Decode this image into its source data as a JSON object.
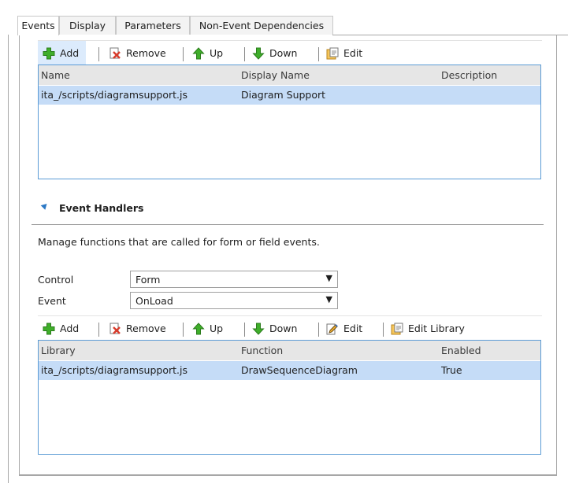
{
  "tabs": [
    {
      "label": "Events",
      "active": true
    },
    {
      "label": "Display",
      "active": false
    },
    {
      "label": "Parameters",
      "active": false
    },
    {
      "label": "Non-Event Dependencies",
      "active": false
    }
  ],
  "libraries_toolbar": {
    "add": "Add",
    "remove": "Remove",
    "up": "Up",
    "down": "Down",
    "edit": "Edit"
  },
  "libraries_grid": {
    "columns": [
      "Name",
      "Display Name",
      "Description"
    ],
    "rows": [
      {
        "name": "ita_/scripts/diagramsupport.js",
        "display_name": "Diagram Support",
        "description": ""
      }
    ]
  },
  "event_handlers": {
    "title": "Event Handlers",
    "description": "Manage functions that are called for form or field events.",
    "control_label": "Control",
    "control_value": "Form",
    "event_label": "Event",
    "event_value": "OnLoad",
    "dropdown_arrow": "▼"
  },
  "handlers_toolbar": {
    "add": "Add",
    "remove": "Remove",
    "up": "Up",
    "down": "Down",
    "edit": "Edit",
    "edit_library": "Edit Library"
  },
  "handlers_grid": {
    "columns": [
      "Library",
      "Function",
      "Enabled"
    ],
    "rows": [
      {
        "library": "ita_/scripts/diagramsupport.js",
        "function": "DrawSequenceDiagram",
        "enabled": "True"
      }
    ]
  },
  "colors": {
    "accent": "#5b9bd5",
    "selected_row": "#c5dcf7",
    "header_bg": "#e6e6e6",
    "highlight_button": "#dcebfc"
  }
}
